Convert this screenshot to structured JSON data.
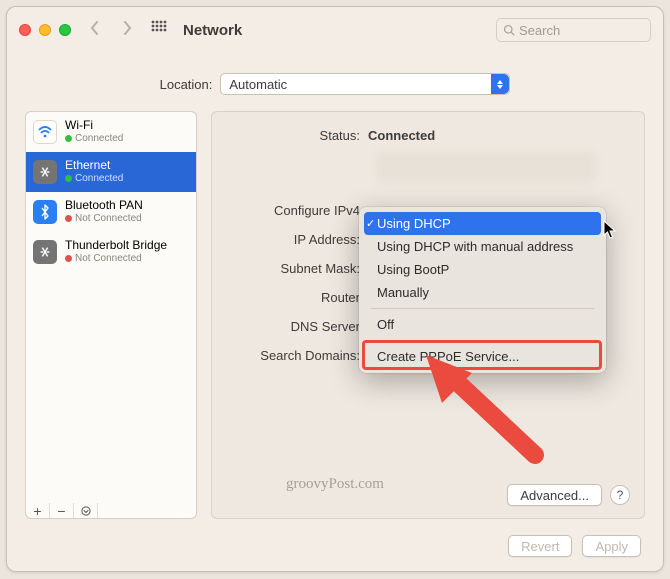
{
  "header": {
    "title": "Network",
    "search_placeholder": "Search"
  },
  "location": {
    "label": "Location:",
    "value": "Automatic"
  },
  "sidebar": {
    "items": [
      {
        "name": "Wi-Fi",
        "status": "Connected",
        "status_color": "green",
        "icon": "wifi"
      },
      {
        "name": "Ethernet",
        "status": "Connected",
        "status_color": "green",
        "icon": "eth",
        "selected": true
      },
      {
        "name": "Bluetooth PAN",
        "status": "Not Connected",
        "status_color": "red",
        "icon": "bt"
      },
      {
        "name": "Thunderbolt Bridge",
        "status": "Not Connected",
        "status_color": "red",
        "icon": "tb"
      }
    ]
  },
  "panel": {
    "status_label": "Status:",
    "status_value": "Connected",
    "fields": {
      "configure_label": "Configure IPv4",
      "ip_label": "IP Address:",
      "subnet_label": "Subnet Mask:",
      "router_label": "Router",
      "dns_label": "DNS Server",
      "search_domains_label": "Search Domains:",
      "search_domains_value": ""
    },
    "advanced_label": "Advanced...",
    "help_label": "?"
  },
  "dropdown": {
    "items": [
      "Using DHCP",
      "Using DHCP with manual address",
      "Using BootP",
      "Manually",
      "Off",
      "Create PPPoE Service..."
    ],
    "selected_index": 0,
    "highlighted_index": 5
  },
  "footer": {
    "revert": "Revert",
    "apply": "Apply"
  },
  "watermark": "groovyPost.com"
}
